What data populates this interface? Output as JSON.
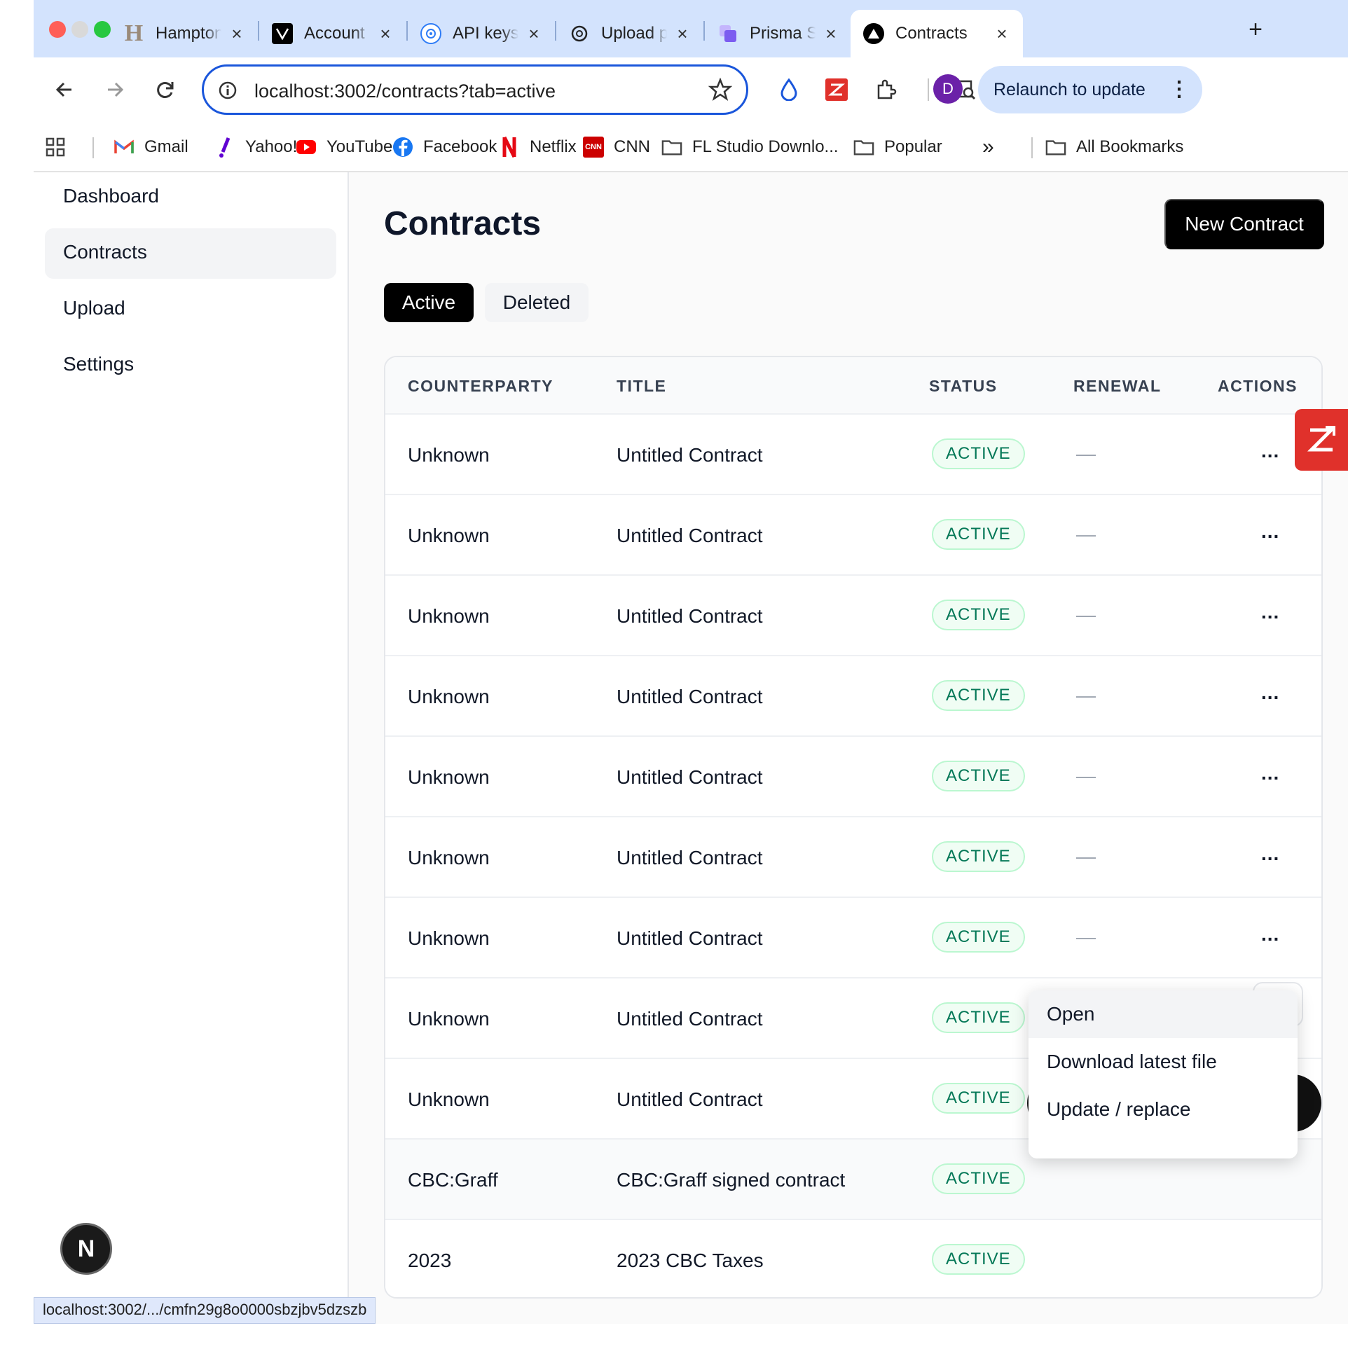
{
  "browser": {
    "tabs": [
      {
        "label": "Hampton E",
        "icon": "hampton-h-icon"
      },
      {
        "label": "Account",
        "icon": "vercel-v-icon"
      },
      {
        "label": "API keys -",
        "icon": "openai-icon"
      },
      {
        "label": "Upload pa",
        "icon": "chatgpt-icon"
      },
      {
        "label": "Prisma Stu",
        "icon": "prisma-icon"
      },
      {
        "label": "Contracts",
        "icon": "contracts-triangle-icon",
        "active": true
      }
    ],
    "url": "localhost:3002/contracts?tab=active",
    "relaunch_label": "Relaunch to update",
    "profile_initial": "D",
    "bookmarks": [
      {
        "label": "Gmail",
        "icon": "gmail-icon"
      },
      {
        "label": "Yahoo!",
        "icon": "yahoo-icon"
      },
      {
        "label": "YouTube",
        "icon": "youtube-icon"
      },
      {
        "label": "Facebook",
        "icon": "facebook-icon"
      },
      {
        "label": "Netflix",
        "icon": "netflix-icon"
      },
      {
        "label": "CNN",
        "icon": "cnn-icon"
      },
      {
        "label": "FL Studio Downlo...",
        "icon": "folder-icon"
      },
      {
        "label": "Popular",
        "icon": "folder-icon"
      }
    ],
    "all_bookmarks_label": "All Bookmarks",
    "status_url": "localhost:3002/.../cmfn29g8o0000sbzjbv5dzszb"
  },
  "sidebar": {
    "items": [
      {
        "label": "Dashboard"
      },
      {
        "label": "Contracts",
        "selected": true
      },
      {
        "label": "Upload"
      },
      {
        "label": "Settings"
      }
    ]
  },
  "main": {
    "title": "Contracts",
    "new_button": "New Contract",
    "tabs": [
      "Active",
      "Deleted"
    ],
    "columns": [
      "COUNTERPARTY",
      "TITLE",
      "STATUS",
      "RENEWAL",
      "ACTIONS"
    ],
    "rows": [
      {
        "counterparty": "Unknown",
        "title": "Untitled Contract",
        "status": "ACTIVE",
        "renewal": "—",
        "actions": "..."
      },
      {
        "counterparty": "Unknown",
        "title": "Untitled Contract",
        "status": "ACTIVE",
        "renewal": "—",
        "actions": "..."
      },
      {
        "counterparty": "Unknown",
        "title": "Untitled Contract",
        "status": "ACTIVE",
        "renewal": "—",
        "actions": "..."
      },
      {
        "counterparty": "Unknown",
        "title": "Untitled Contract",
        "status": "ACTIVE",
        "renewal": "—",
        "actions": "..."
      },
      {
        "counterparty": "Unknown",
        "title": "Untitled Contract",
        "status": "ACTIVE",
        "renewal": "—",
        "actions": "..."
      },
      {
        "counterparty": "Unknown",
        "title": "Untitled Contract",
        "status": "ACTIVE",
        "renewal": "—",
        "actions": "..."
      },
      {
        "counterparty": "Unknown",
        "title": "Untitled Contract",
        "status": "ACTIVE",
        "renewal": "—",
        "actions": "..."
      },
      {
        "counterparty": "Unknown",
        "title": "Untitled Contract",
        "status": "ACTIVE",
        "renewal": "—",
        "actions": "..."
      },
      {
        "counterparty": "Unknown",
        "title": "Untitled Contract",
        "status": "ACTIVE",
        "renewal": "—",
        "actions": "..."
      },
      {
        "counterparty": "CBC:Graff",
        "title": "CBC:Graff signed contract",
        "status": "ACTIVE",
        "renewal": "",
        "actions": ""
      },
      {
        "counterparty": "2023",
        "title": "2023 CBC Taxes",
        "status": "ACTIVE",
        "renewal": "",
        "actions": ""
      }
    ],
    "row_menu": [
      "Open",
      "Download latest file",
      "Update / replace"
    ]
  },
  "overlays": {
    "next_badge": "N",
    "colors": {
      "accent": "#000000",
      "status_green": "#047857",
      "omnibox_border": "#1a56db"
    }
  }
}
